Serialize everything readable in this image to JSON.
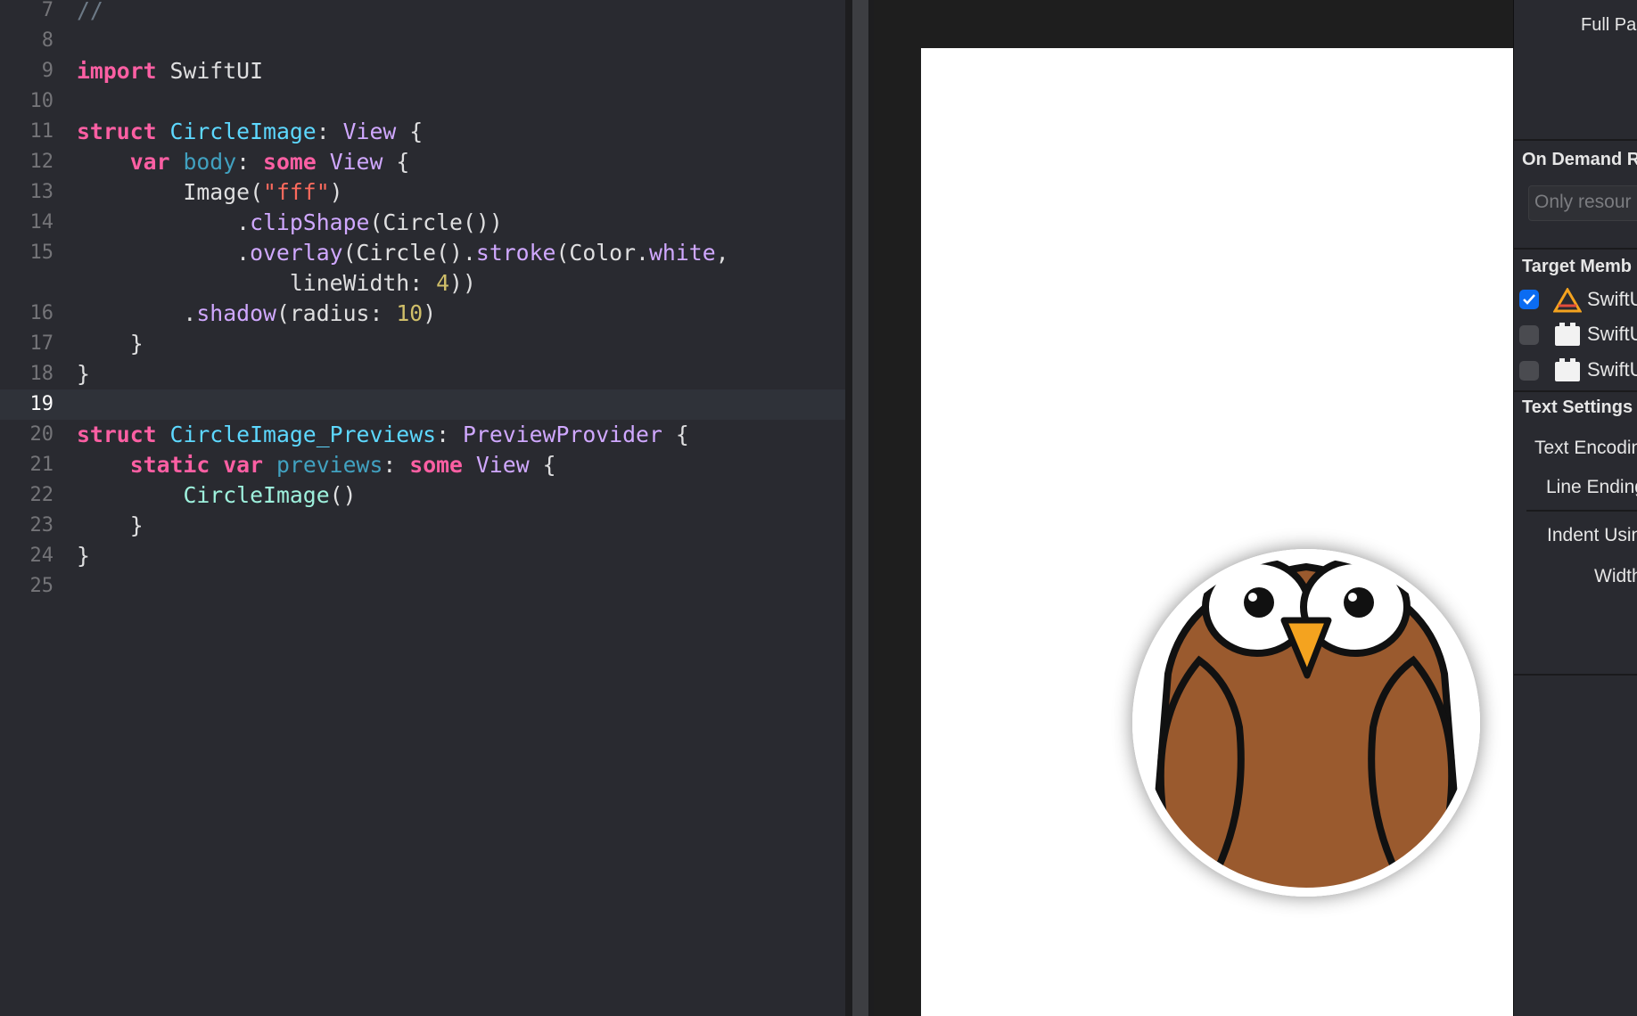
{
  "editor": {
    "current_line": "19",
    "lines": [
      {
        "n": "7",
        "text": "//"
      },
      {
        "n": "8",
        "text": ""
      },
      {
        "n": "9",
        "text": "import SwiftUI"
      },
      {
        "n": "10",
        "text": ""
      },
      {
        "n": "11",
        "text": "struct CircleImage: View {"
      },
      {
        "n": "12",
        "text": "    var body: some View {"
      },
      {
        "n": "13",
        "text": "        Image(\"fff\")"
      },
      {
        "n": "14",
        "text": "            .clipShape(Circle())"
      },
      {
        "n": "15",
        "text": "            .overlay(Circle().stroke(Color.white,"
      },
      {
        "n": "",
        "text": "                lineWidth: 4))"
      },
      {
        "n": "16",
        "text": "        .shadow(radius: 10)"
      },
      {
        "n": "17",
        "text": "    }"
      },
      {
        "n": "18",
        "text": "}"
      },
      {
        "n": "19",
        "text": ""
      },
      {
        "n": "20",
        "text": "struct CircleImage_Previews: PreviewProvider {"
      },
      {
        "n": "21",
        "text": "    static var previews: some View {"
      },
      {
        "n": "22",
        "text": "        CircleImage()"
      },
      {
        "n": "23",
        "text": "    }"
      },
      {
        "n": "24",
        "text": "}"
      },
      {
        "n": "25",
        "text": ""
      }
    ]
  },
  "preview": {
    "image_icon": "owl-image-icon"
  },
  "inspector": {
    "full_path_label": "Full Pa",
    "on_demand_title": "On Demand R",
    "on_demand_placeholder": "Only resour",
    "target_membership_title": "Target Memb",
    "targets": [
      {
        "label": "SwiftU",
        "checked": true,
        "icon": "app-target-icon"
      },
      {
        "label": "SwiftU",
        "checked": false,
        "icon": "framework-target-icon"
      },
      {
        "label": "SwiftU",
        "checked": false,
        "icon": "framework-target-icon"
      }
    ],
    "text_settings_title": "Text Settings",
    "text_encoding_label": "Text Encodin",
    "line_endings_label": "Line Ending",
    "indent_using_label": "Indent Usin",
    "widths_label": "Width"
  },
  "colors": {
    "editor_bg": "#292a30",
    "keyword": "#fc5fa3",
    "type": "#5dd8ff",
    "string": "#fc6a5d",
    "number": "#d0bf69",
    "checkbox_on": "#0b6cf2",
    "owl_body": "#9a5a2e"
  }
}
